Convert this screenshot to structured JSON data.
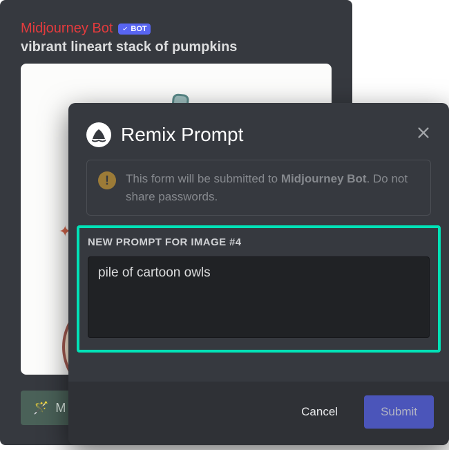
{
  "message": {
    "author": "Midjourney Bot",
    "bot_badge": "BOT",
    "prompt": "vibrant lineart stack of pumpkins"
  },
  "hidden_button_hint": "M",
  "modal": {
    "title": "Remix Prompt",
    "notice_prefix": "This form will be submitted to ",
    "notice_bot": "Midjourney Bot",
    "notice_suffix": ". Do not share passwords.",
    "field_label": "NEW PROMPT FOR IMAGE #4",
    "prompt_value": "pile of cartoon owls",
    "cancel": "Cancel",
    "submit": "Submit"
  }
}
